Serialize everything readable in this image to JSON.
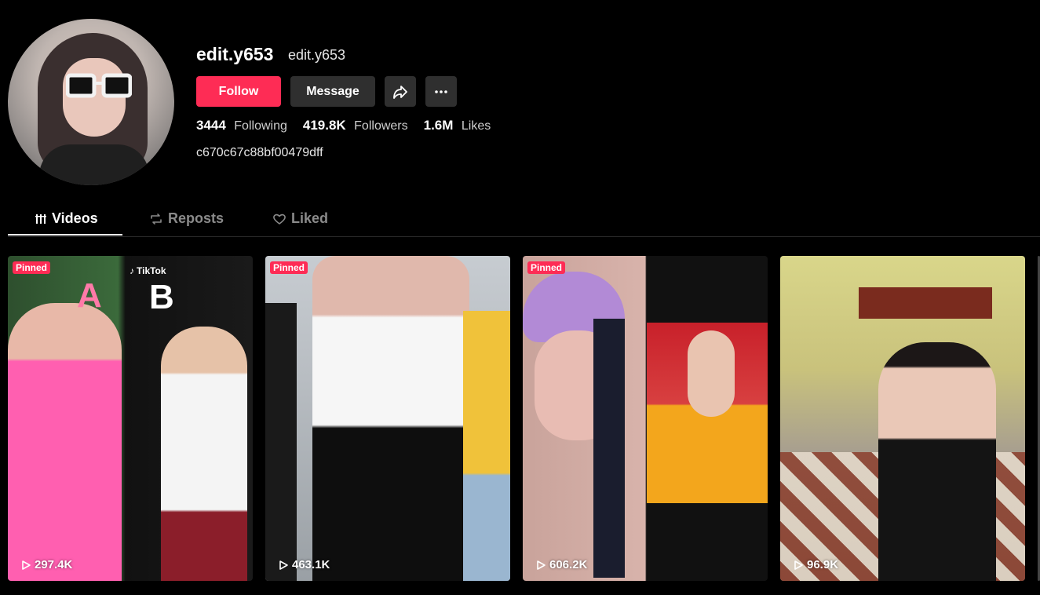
{
  "profile": {
    "username": "edit.y653",
    "nickname": "edit.y653",
    "bio": "c670c67c88bf00479dff",
    "avatar_icon": "profile-avatar"
  },
  "actions": {
    "follow_label": "Follow",
    "message_label": "Message",
    "share_icon": "share-icon",
    "more_icon": "more-icon"
  },
  "stats": {
    "following_count": "3444",
    "following_label": "Following",
    "followers_count": "419.8K",
    "followers_label": "Followers",
    "likes_count": "1.6M",
    "likes_label": "Likes"
  },
  "tabs": [
    {
      "label": "Videos",
      "icon": "grid-icon",
      "active": true
    },
    {
      "label": "Reposts",
      "icon": "repost-icon",
      "active": false
    },
    {
      "label": "Liked",
      "icon": "heart-icon",
      "active": false
    }
  ],
  "videos": [
    {
      "pinned_label": "Pinned",
      "views": "297.4K",
      "overlay_a": "A",
      "overlay_b": "B",
      "watermark": "TikTok"
    },
    {
      "pinned_label": "Pinned",
      "views": "463.1K"
    },
    {
      "pinned_label": "Pinned",
      "views": "606.2K"
    },
    {
      "views": "96.9K"
    }
  ],
  "colors": {
    "background": "#000000",
    "accent": "#fe2c55",
    "button_secondary": "#2f2f2f",
    "muted_text": "#8a8a8a"
  }
}
